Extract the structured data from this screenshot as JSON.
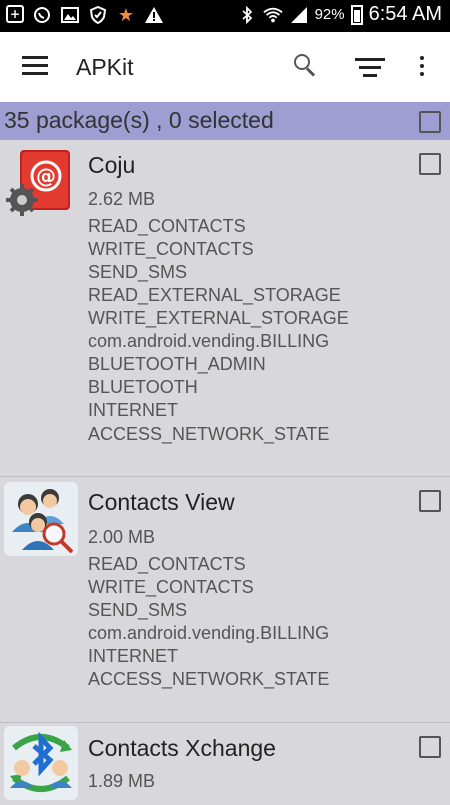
{
  "status_bar": {
    "battery_pct": "92%",
    "time": "6:54 AM"
  },
  "toolbar": {
    "title": "APKit"
  },
  "summary": {
    "text": "35 package(s) , 0 selected"
  },
  "packages": [
    {
      "name": "Coju",
      "size": "2.62 MB",
      "permissions": [
        "READ_CONTACTS",
        "WRITE_CONTACTS",
        "SEND_SMS",
        "READ_EXTERNAL_STORAGE",
        "WRITE_EXTERNAL_STORAGE",
        "com.android.vending.BILLING",
        "BLUETOOTH_ADMIN",
        "BLUETOOTH",
        "INTERNET",
        "ACCESS_NETWORK_STATE"
      ]
    },
    {
      "name": "Contacts View",
      "size": "2.00 MB",
      "permissions": [
        "READ_CONTACTS",
        "WRITE_CONTACTS",
        "SEND_SMS",
        "com.android.vending.BILLING",
        "INTERNET",
        "ACCESS_NETWORK_STATE"
      ]
    },
    {
      "name": "Contacts Xchange",
      "size": "1.89 MB",
      "permissions": []
    }
  ]
}
